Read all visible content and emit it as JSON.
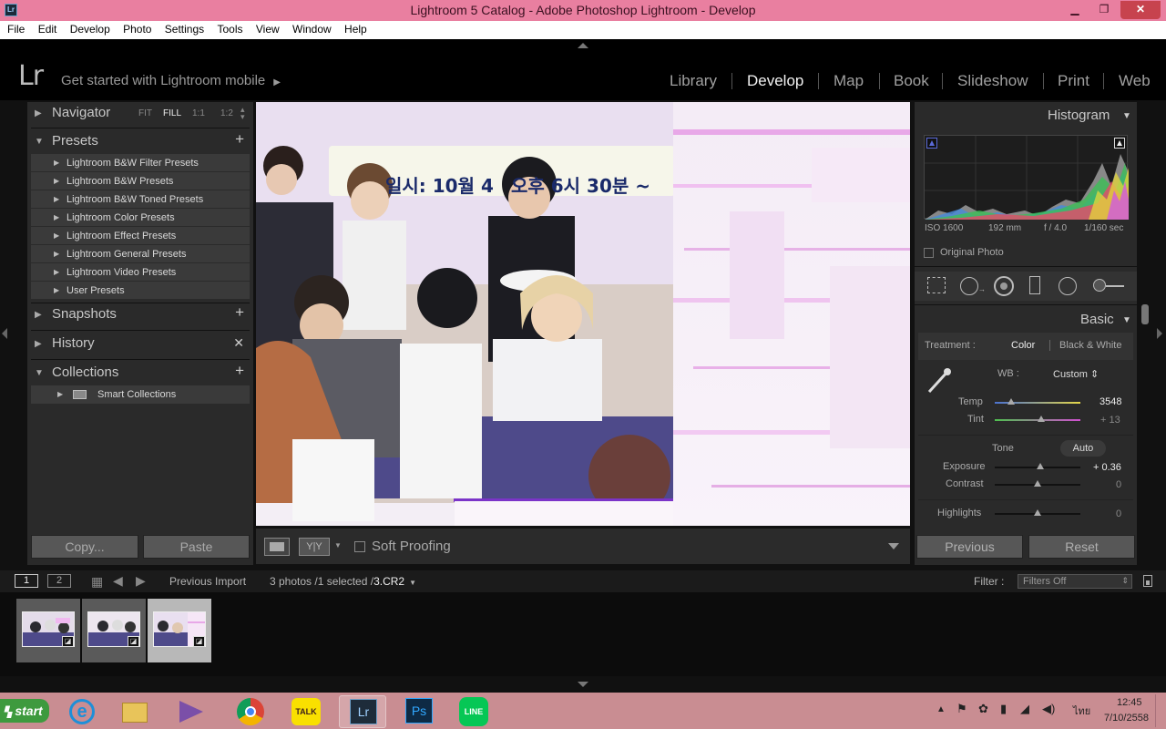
{
  "window": {
    "title": "Lightroom 5 Catalog - Adobe Photoshop Lightroom - Develop",
    "app_icon": "Lr"
  },
  "menubar": [
    "File",
    "Edit",
    "Develop",
    "Photo",
    "Settings",
    "Tools",
    "View",
    "Window",
    "Help"
  ],
  "identity": {
    "logo": "Lr",
    "mobile_text": "Get started with Lightroom mobile"
  },
  "modules": [
    "Library",
    "Develop",
    "Map",
    "Book",
    "Slideshow",
    "Print",
    "Web"
  ],
  "active_module": "Develop",
  "left_panel": {
    "navigator": {
      "label": "Navigator",
      "zoom_options": [
        "FIT",
        "FILL",
        "1:1",
        "1:2"
      ],
      "zoom_selected": "FILL"
    },
    "presets": {
      "label": "Presets",
      "items": [
        "Lightroom B&W Filter Presets",
        "Lightroom B&W Presets",
        "Lightroom B&W Toned Presets",
        "Lightroom Color Presets",
        "Lightroom Effect Presets",
        "Lightroom General Presets",
        "Lightroom Video Presets",
        "User Presets"
      ]
    },
    "snapshots": "Snapshots",
    "history": "History",
    "collections": {
      "label": "Collections",
      "items": [
        "Smart Collections"
      ]
    },
    "copy_button": "Copy...",
    "paste_button": "Paste"
  },
  "photo": {
    "banner_text": "일시: 10월 4",
    "banner_text_2": "오후 6시 30분 ~"
  },
  "toolbar": {
    "soft_proofing": "Soft Proofing"
  },
  "right_panel": {
    "histogram": {
      "label": "Histogram",
      "iso": "ISO 1600",
      "focal": "192 mm",
      "aperture": "f / 4.0",
      "shutter": "1/160 sec",
      "original_photo": "Original Photo"
    },
    "basic": {
      "label": "Basic",
      "treatment_label": "Treatment :",
      "treatment_color": "Color",
      "treatment_bw": "Black & White",
      "wb_label": "WB :",
      "wb_value": "Custom",
      "temp_label": "Temp",
      "temp_value": "3548",
      "tint_label": "Tint",
      "tint_value": "+ 13",
      "tone_label": "Tone",
      "auto_label": "Auto",
      "exposure_label": "Exposure",
      "exposure_value": "+ 0.36",
      "contrast_label": "Contrast",
      "contrast_value": "0",
      "highlights_label": "Highlights",
      "highlights_value": "0"
    },
    "previous_button": "Previous",
    "reset_button": "Reset"
  },
  "filmstrip_bar": {
    "page1": "1",
    "page2": "2",
    "previous_import": "Previous Import",
    "photo_count": "3 photos /1 selected /",
    "filename": "3.CR2",
    "filter_label": "Filter :",
    "filter_value": "Filters Off"
  },
  "filmstrip": {
    "thumbnail_count": 3,
    "selected_index": 2
  },
  "taskbar": {
    "start_label": "start",
    "apps": [
      "internet-explorer",
      "file-explorer",
      "visual-studio",
      "chrome",
      "kakaotalk",
      "lightroom",
      "photoshop",
      "line"
    ],
    "active_app": "lightroom",
    "lang": "ไทย",
    "time": "12:45",
    "date": "7/10/2558"
  },
  "colors": {
    "titlebar": "#e97fa0",
    "taskbar": "#c98d92",
    "panel_bg": "#2a2a2a",
    "active_text": "#f2f2f2"
  }
}
